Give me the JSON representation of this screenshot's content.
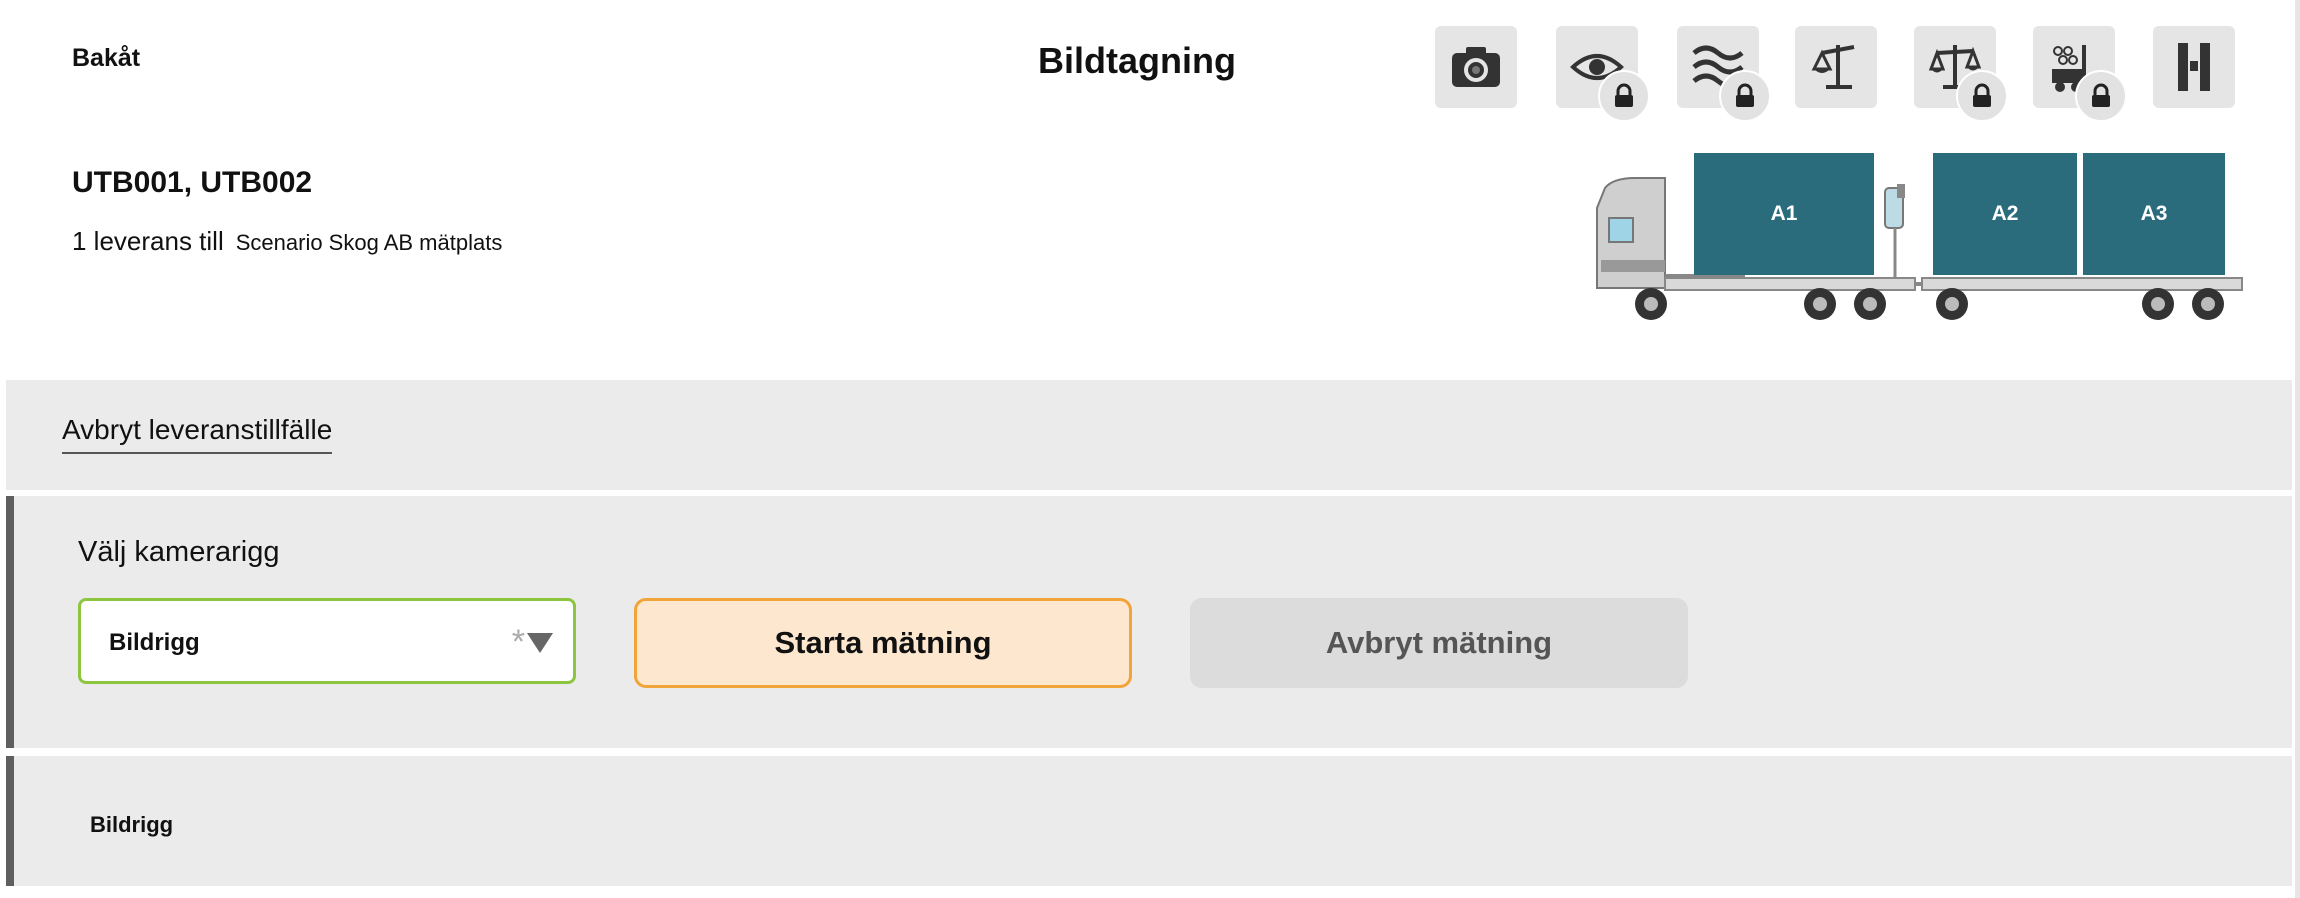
{
  "header": {
    "back_label": "Bakåt",
    "title": "Bildtagning",
    "toolbar": [
      {
        "name": "camera-icon",
        "locked": false
      },
      {
        "name": "eye-icon",
        "locked": true
      },
      {
        "name": "moisture-icon",
        "locked": true
      },
      {
        "name": "crane-scale-icon",
        "locked": false
      },
      {
        "name": "balance-scale-icon",
        "locked": true
      },
      {
        "name": "forklift-icon",
        "locked": true
      },
      {
        "name": "road-icon",
        "locked": false
      }
    ]
  },
  "delivery": {
    "ids": "UTB001, UTB002",
    "count_text": "1 leverans till",
    "destination": "Scenario Skog AB mätplats"
  },
  "vehicle": {
    "load_labels": [
      "A1",
      "A2",
      "A3"
    ],
    "load_color": "#2a6b7c"
  },
  "cancel_occasion": {
    "label": "Avbryt leveranstillfälle"
  },
  "camera": {
    "label": "Välj kamerarigg",
    "select_value": "Bildrigg",
    "required_mark": "*",
    "start_label": "Starta mätning",
    "abort_label": "Avbryt mätning"
  },
  "rig": {
    "value": "Bildrigg"
  },
  "colors": {
    "accent_green": "#8cc63f",
    "start_bg": "#fde8cf",
    "start_border": "#f0a43a",
    "section_bg": "#ebebeb"
  }
}
